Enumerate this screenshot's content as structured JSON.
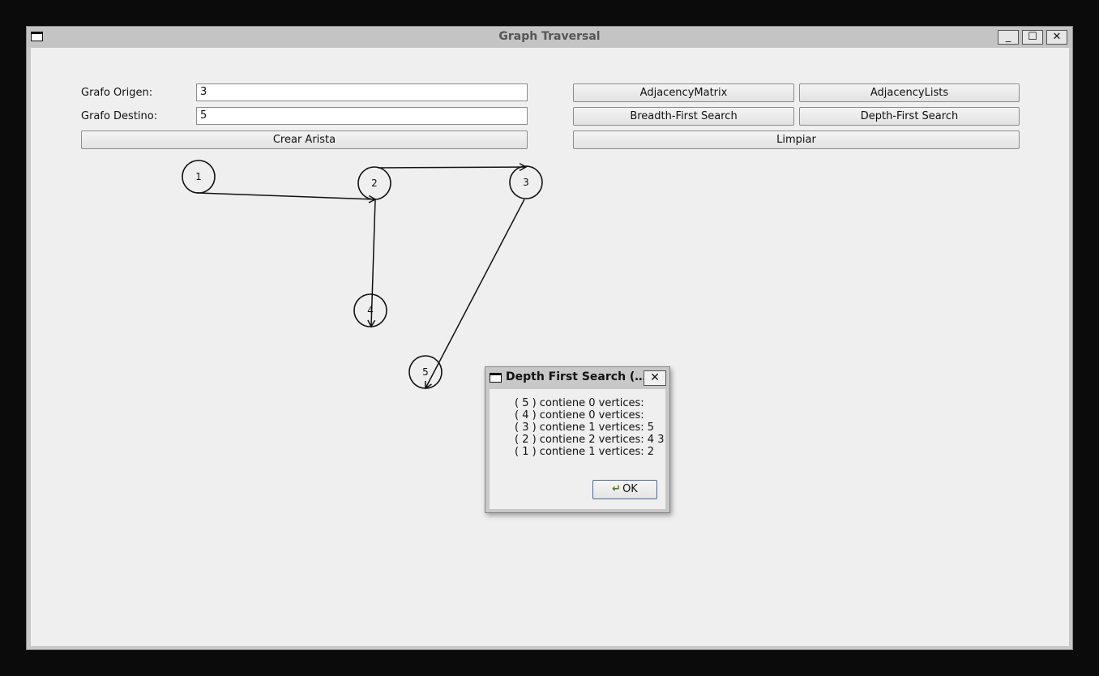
{
  "window": {
    "title": "Graph Traversal",
    "minimize_glyph": "_",
    "maximize_glyph": "☐",
    "close_glyph": "✕"
  },
  "form": {
    "origin_label": "Grafo Origen:",
    "origin_value": "3",
    "dest_label": "Grafo Destino:",
    "dest_value": "5",
    "create_edge_label": "Crear Arista"
  },
  "actions": {
    "adjacency_matrix": "AdjacencyMatrix",
    "adjacency_lists": "AdjacencyLists",
    "bfs": "Breadth-First Search",
    "dfs": "Depth-First Search",
    "clear": "Limpiar"
  },
  "graph": {
    "nodes": [
      {
        "id": "1"
      },
      {
        "id": "2"
      },
      {
        "id": "3"
      },
      {
        "id": "4"
      },
      {
        "id": "5"
      }
    ],
    "edges": [
      {
        "from": "1",
        "to": "2"
      },
      {
        "from": "2",
        "to": "3"
      },
      {
        "from": "2",
        "to": "4"
      },
      {
        "from": "3",
        "to": "5"
      }
    ]
  },
  "dialog": {
    "title": "Depth First Search (…",
    "close_glyph": "✕",
    "lines": [
      "( 5 ) contiene 0 vertices:",
      "( 4 ) contiene 0 vertices:",
      "( 3 ) contiene 1 vertices: 5",
      "( 2 ) contiene 2 vertices: 4 3",
      "( 1 ) contiene 1 vertices: 2"
    ],
    "ok_label": "OK"
  }
}
